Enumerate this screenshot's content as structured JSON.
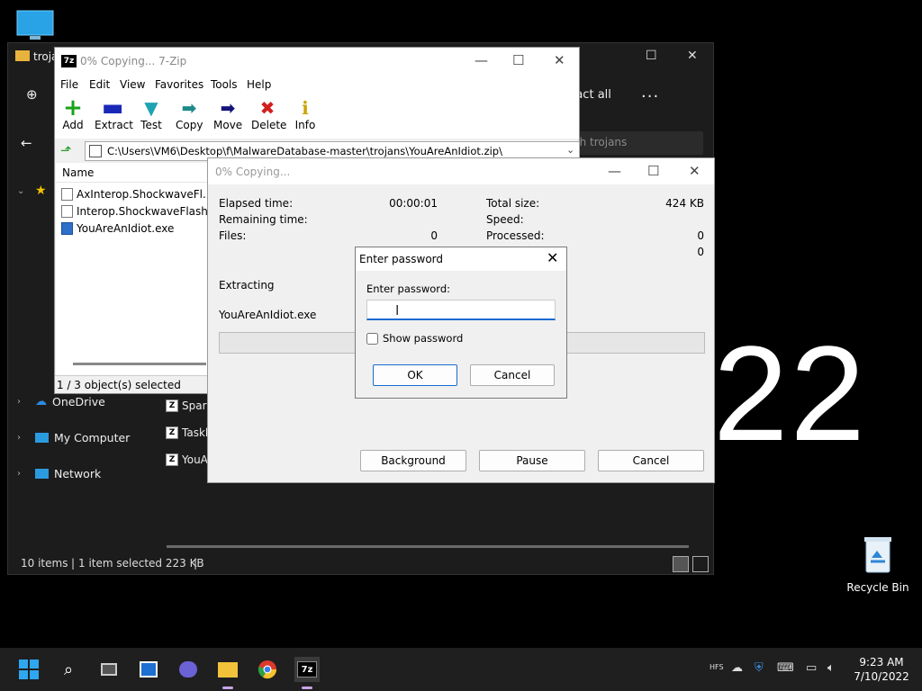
{
  "desktop": {
    "big_text": "22",
    "recycle_bin_label": "Recycle Bin"
  },
  "explorer": {
    "title": "troja",
    "extract_all": "ract all",
    "more": "...",
    "search_placeholder": "ch trojans",
    "nav": [
      "OneDrive",
      "My Computer",
      "Network"
    ],
    "files": [
      "Spar",
      "Taskl",
      "YouA"
    ],
    "status_items": "10 items",
    "status_selected": "1 item selected  223 KB"
  },
  "zip": {
    "title": "0% Copying... 7-Zip",
    "logo": "7z",
    "menu": [
      "File",
      "Edit",
      "View",
      "Favorites",
      "Tools",
      "Help"
    ],
    "toolbar": [
      {
        "label": "Add",
        "icon": "plus-icon",
        "color": "#19a319"
      },
      {
        "label": "Extract",
        "icon": "minus-icon",
        "color": "#1a28b8"
      },
      {
        "label": "Test",
        "icon": "check-icon",
        "color": "#1fa3b3"
      },
      {
        "label": "Copy",
        "icon": "arrow-right-icon",
        "color": "#1f8a8a"
      },
      {
        "label": "Move",
        "icon": "arrow-right-icon",
        "color": "#14147a"
      },
      {
        "label": "Delete",
        "icon": "x-icon",
        "color": "#d11f1f"
      },
      {
        "label": "Info",
        "icon": "info-icon",
        "color": "#c9a400"
      }
    ],
    "address": "C:\\Users\\VM6\\Desktop\\f\\MalwareDatabase-master\\trojans\\YouAreAnIdiot.zip\\",
    "column_name": "Name",
    "files": [
      "AxInterop.ShockwaveFl...",
      "Interop.ShockwaveFlash...",
      "YouAreAnIdiot.exe"
    ],
    "status": "1 / 3 object(s) selected"
  },
  "copy": {
    "title": "0% Copying...",
    "elapsed_label": "Elapsed time:",
    "elapsed_value": "00:00:01",
    "remaining_label": "Remaining time:",
    "files_label": "Files:",
    "files_value": "0",
    "total_label": "Total size:",
    "total_value": "424 KB",
    "speed_label": "Speed:",
    "processed_label": "Processed:",
    "processed_value": "0",
    "second_value": "0",
    "operation": "Extracting",
    "current_file": "YouAreAnIdiot.exe",
    "progress": 0,
    "buttons": {
      "background": "Background",
      "pause": "Pause",
      "cancel": "Cancel"
    }
  },
  "password": {
    "title": "Enter password",
    "label": "Enter password:",
    "value": "",
    "show_password": "Show password",
    "ok": "OK",
    "cancel": "Cancel"
  },
  "taskbar": {
    "lang": "HFS",
    "time": "9:23 AM",
    "date": "7/10/2022"
  }
}
